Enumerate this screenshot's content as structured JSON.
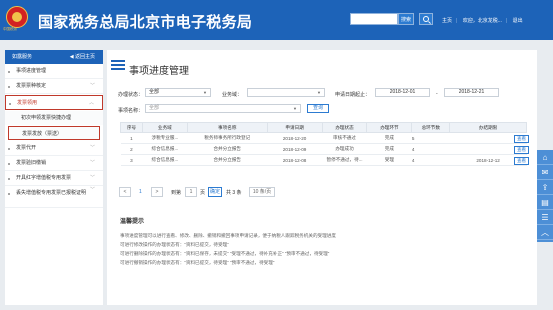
{
  "header": {
    "logo_text": "中国税务",
    "title": "国家税务总局北京市电子税务局",
    "search_placeholder": "",
    "search_button": "搜索",
    "links": [
      "主页",
      "欢迎，北京龙税...",
      "退出"
    ]
  },
  "sidebar": {
    "head_label": "如露服务",
    "back_label": "◀ 返回主页",
    "items": [
      {
        "label": "事项进度管理",
        "chevron": ""
      },
      {
        "label": "发票票种核定",
        "chevron": "﹀"
      },
      {
        "label": "发票领用",
        "chevron": "︿"
      },
      {
        "label": "初次申领发票快捷办理"
      },
      {
        "label": "发票发放（票送）"
      },
      {
        "label": "发票代开",
        "chevron": "﹀"
      },
      {
        "label": "发票验旧缴销",
        "chevron": "﹀"
      },
      {
        "label": "开具红字增值税专用发票",
        "chevron": "﹀"
      },
      {
        "label": "丢失增值税专用发票已报税证明",
        "chevron": "﹀"
      }
    ]
  },
  "main": {
    "title": "事项进度管理",
    "filters": {
      "status_label": "办理状态：",
      "status_value": "全部",
      "domain_label": "业务域：",
      "domain_value": "",
      "date_label": "申请日期起止：",
      "date_from": "2018-12-01",
      "date_sep": "-",
      "date_to": "2018-12-21",
      "item_label": "事项名称：",
      "item_value": "全部",
      "query_button": "查询"
    },
    "columns": [
      "序号",
      "业务域",
      "事项名称",
      "申请日期",
      "办理状态",
      "办理环节",
      "总环节数",
      "办结期限"
    ],
    "rows": [
      {
        "no": "1",
        "domain": "涉税专业服...",
        "name": "税务师事务所行政登记",
        "date": "2018-12-20",
        "status": "审核不通过",
        "step": "完成",
        "total": "5",
        "deadline": ""
      },
      {
        "no": "2",
        "domain": "综合信息报...",
        "name": "合并分立报告",
        "date": "2018-12-09",
        "status": "办理成功",
        "step": "完成",
        "total": "4",
        "deadline": ""
      },
      {
        "no": "3",
        "domain": "综合信息报...",
        "name": "合并分立报告",
        "date": "2018-12-08",
        "status": "暂停不通过，待...",
        "step": "受理",
        "total": "4",
        "deadline": "2018-12-12"
      }
    ],
    "view_label": "查看",
    "pager": {
      "prev": "<",
      "page": "1",
      "next": ">",
      "goto": "到第",
      "goto_page": "1",
      "page_unit": "页",
      "confirm": "确定",
      "total": "共 3 条",
      "per_page": "10 条/页"
    },
    "tips": {
      "title": "温馨提示",
      "lines": [
        "事项进度管理可以进行查看、修改、删除、撤销和撤回事项申请记录，便于纳税人跟踪税务机关的受理进度",
        "可进行修改操作的办理状态有：“资料已提交，待受理”",
        "可进行删除操作的办理状态有：“资料已保存，未提交” “受理不通过，待补充补正” “预审不通过，待受理”",
        "可进行撤销操作的办理状态有：“资料已提交，待受理”  “预审不通过，待受理”"
      ]
    }
  },
  "float_bar": {
    "icons": [
      "home-icon",
      "chat-icon",
      "share-icon",
      "doc-icon",
      "list-icon",
      "top-icon"
    ]
  },
  "colors": {
    "brand": "#1d63b8",
    "accent": "#2c7bd1",
    "highlight": "#c0392b"
  }
}
